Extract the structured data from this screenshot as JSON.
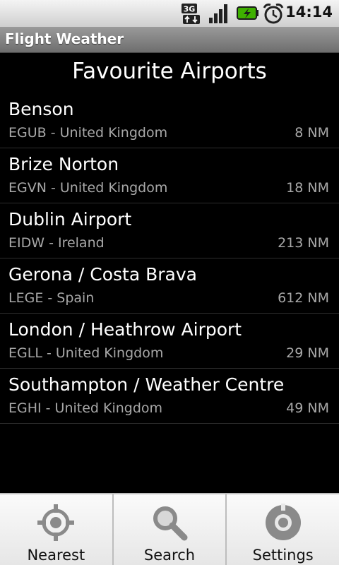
{
  "status_bar": {
    "network_label": "3G",
    "time": "14:14"
  },
  "app": {
    "title": "Flight Weather"
  },
  "list": {
    "header": "Favourite Airports",
    "items": [
      {
        "name": "Benson",
        "subtitle": "EGUB - United Kingdom",
        "distance": "8 NM"
      },
      {
        "name": "Brize Norton",
        "subtitle": "EGVN - United Kingdom",
        "distance": "18 NM"
      },
      {
        "name": "Dublin Airport",
        "subtitle": "EIDW - Ireland",
        "distance": "213 NM"
      },
      {
        "name": "Gerona / Costa Brava",
        "subtitle": "LEGE - Spain",
        "distance": "612 NM"
      },
      {
        "name": "London / Heathrow Airport",
        "subtitle": "EGLL - United Kingdom",
        "distance": "29 NM"
      },
      {
        "name": "Southampton / Weather Centre",
        "subtitle": "EGHI - United Kingdom",
        "distance": "49 NM"
      }
    ]
  },
  "bottom_bar": {
    "buttons": [
      {
        "label": "Nearest",
        "icon": "crosshair-icon"
      },
      {
        "label": "Search",
        "icon": "magnifier-icon"
      },
      {
        "label": "Settings",
        "icon": "dial-icon"
      }
    ]
  },
  "colors": {
    "background": "#000000",
    "secondary_text": "#a8a8a8",
    "battery_green": "#3fb000"
  }
}
